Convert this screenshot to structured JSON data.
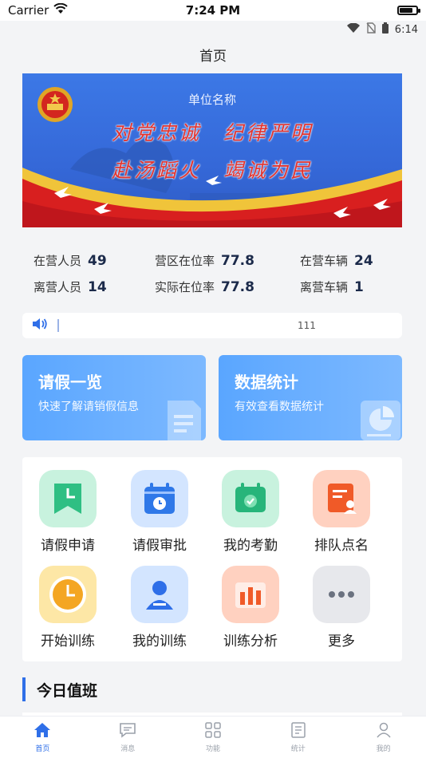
{
  "ios_status": {
    "carrier": "Carrier",
    "time": "7:24 PM"
  },
  "android_status": {
    "time": "6:14"
  },
  "nav": {
    "title": "首页"
  },
  "banner": {
    "unit_name": "单位名称",
    "slogan_line1": "对党忠诚　纪律严明",
    "slogan_line2": "赴汤蹈火　竭诚为民"
  },
  "stats": {
    "in_camp_people": {
      "label": "在营人员",
      "value": "49"
    },
    "camp_presence_rate": {
      "label": "营区在位率",
      "value": "77.8"
    },
    "in_camp_vehicles": {
      "label": "在营车辆",
      "value": "24"
    },
    "away_people": {
      "label": "离营人员",
      "value": "14"
    },
    "actual_presence_rate": {
      "label": "实际在位率",
      "value": "77.8"
    },
    "away_vehicles": {
      "label": "离营车辆",
      "value": "1"
    }
  },
  "notice": {
    "icon": "speaker-icon",
    "text": "111"
  },
  "cards": {
    "leave": {
      "title": "请假一览",
      "subtitle": "快速了解请销假信息"
    },
    "stats": {
      "title": "数据统计",
      "subtitle": "有效查看数据统计"
    }
  },
  "functions": [
    {
      "label": "请假申请",
      "icon": "bookmark-clock-icon",
      "color": "#2fbf83"
    },
    {
      "label": "请假审批",
      "icon": "calendar-clock-icon",
      "color": "#2f78e8"
    },
    {
      "label": "我的考勤",
      "icon": "calendar-check-icon",
      "color": "#27b57a"
    },
    {
      "label": "排队点名",
      "icon": "roster-person-icon",
      "color": "#f05a28"
    },
    {
      "label": "开始训练",
      "icon": "clock-icon",
      "color": "#f4a623"
    },
    {
      "label": "我的训练",
      "icon": "person-icon",
      "color": "#2f6fe8"
    },
    {
      "label": "训练分析",
      "icon": "bar-chart-icon",
      "color": "#f05a28"
    },
    {
      "label": "更多",
      "icon": "more-icon",
      "color": "#6b7280"
    }
  ],
  "duty": {
    "title": "今日值班"
  },
  "tabs": [
    {
      "label": "首页",
      "icon": "home-icon"
    },
    {
      "label": "消息",
      "icon": "message-icon"
    },
    {
      "label": "功能",
      "icon": "grid-icon"
    },
    {
      "label": "统计",
      "icon": "report-icon"
    },
    {
      "label": "我的",
      "icon": "user-icon"
    }
  ],
  "colors": {
    "primary": "#2f6fe8",
    "banner": "#3a73e0",
    "slogan": "#e3342f"
  }
}
